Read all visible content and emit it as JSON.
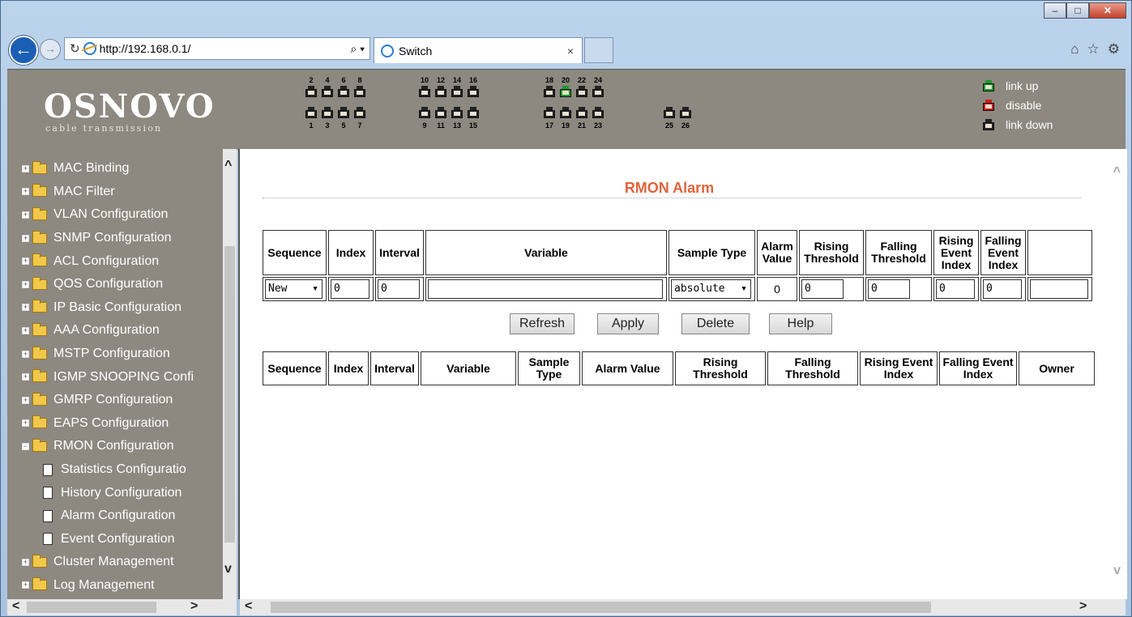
{
  "browser": {
    "url": "http://192.168.0.1/",
    "tab_title": "Switch",
    "tab_close": "×"
  },
  "logo": {
    "name": "OSNOVO",
    "tagline": "cable transmission"
  },
  "ports": {
    "top_numbers": [
      "2",
      "4",
      "6",
      "8",
      "10",
      "12",
      "14",
      "16",
      "18",
      "20",
      "22",
      "24"
    ],
    "bottom_numbers": [
      "1",
      "3",
      "5",
      "7",
      "9",
      "11",
      "13",
      "15",
      "17",
      "19",
      "21",
      "23",
      "25",
      "26"
    ],
    "link_up_port": "20"
  },
  "legend": {
    "up": "link up",
    "disable": "disable",
    "down": "link down"
  },
  "sidebar": {
    "items": [
      {
        "label": "MAC Binding",
        "type": "folder"
      },
      {
        "label": "MAC Filter",
        "type": "folder"
      },
      {
        "label": "VLAN Configuration",
        "type": "folder"
      },
      {
        "label": "SNMP Configuration",
        "type": "folder"
      },
      {
        "label": "ACL Configuration",
        "type": "folder"
      },
      {
        "label": "QOS Configuration",
        "type": "folder"
      },
      {
        "label": "IP Basic Configuration",
        "type": "folder"
      },
      {
        "label": "AAA Configuration",
        "type": "folder"
      },
      {
        "label": "MSTP Configuration",
        "type": "folder"
      },
      {
        "label": "IGMP SNOOPING Confi",
        "type": "folder"
      },
      {
        "label": "GMRP Configuration",
        "type": "folder"
      },
      {
        "label": "EAPS Configuration",
        "type": "folder"
      },
      {
        "label": "RMON Configuration",
        "type": "open-folder"
      },
      {
        "label": "Statistics Configuratio",
        "type": "doc"
      },
      {
        "label": "History Configuration",
        "type": "doc"
      },
      {
        "label": "Alarm Configuration",
        "type": "doc"
      },
      {
        "label": "Event Configuration",
        "type": "doc"
      },
      {
        "label": "Cluster Management",
        "type": "folder"
      },
      {
        "label": "Log Management",
        "type": "folder"
      }
    ]
  },
  "page": {
    "title": "RMON Alarm",
    "form_headers": [
      "Sequence",
      "Index",
      "Interval",
      "Variable",
      "Sample Type",
      "Alarm Value",
      "Rising Threshold",
      "Falling Threshold",
      "Rising Event Index",
      "Falling Event Index",
      ""
    ],
    "form_values": {
      "sequence": "New",
      "index": "0",
      "interval": "0",
      "variable": "",
      "sample_type": "absolute",
      "alarm_value": "0",
      "rising_threshold": "0",
      "falling_threshold": "0",
      "rising_event_index": "0",
      "falling_event_index": "0",
      "owner": ""
    },
    "buttons": {
      "refresh": "Refresh",
      "apply": "Apply",
      "delete": "Delete",
      "help": "Help"
    },
    "list_headers": [
      "Sequence",
      "Index",
      "Interval",
      "Variable",
      "Sample Type",
      "Alarm Value",
      "Rising Threshold",
      "Falling Threshold",
      "Rising Event Index",
      "Falling Event Index",
      "Owner"
    ]
  }
}
